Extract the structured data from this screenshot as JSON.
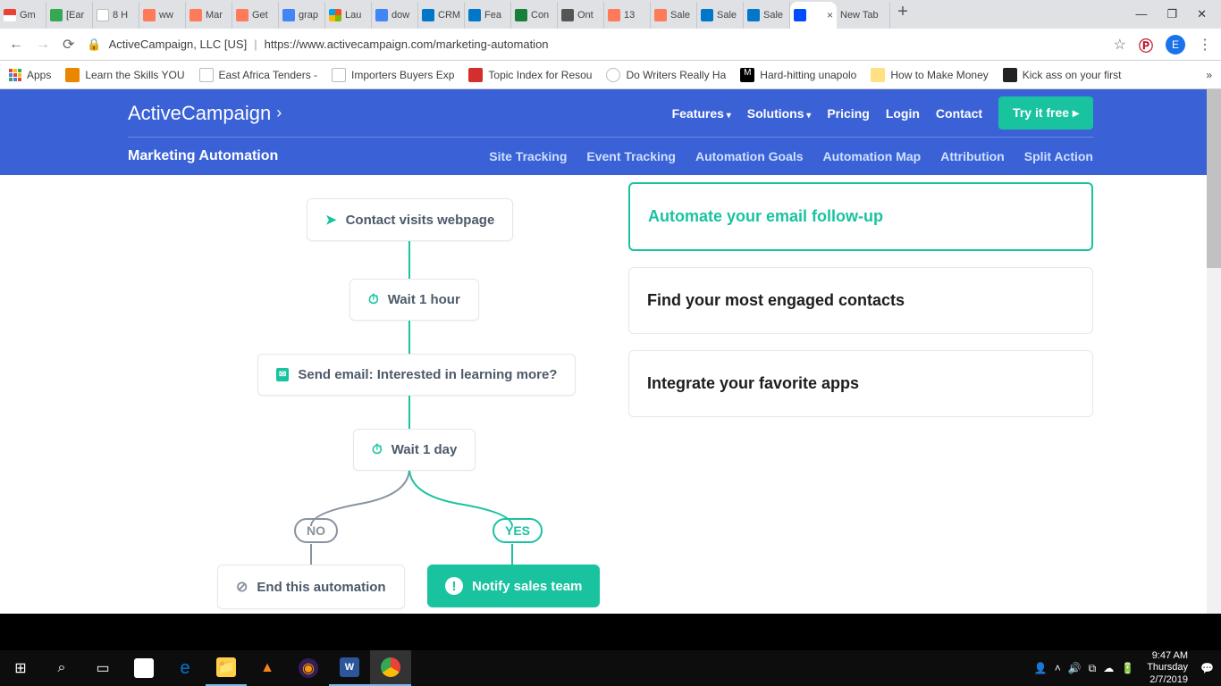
{
  "browser": {
    "tabs": [
      {
        "label": "Gm",
        "color": "#ea4335"
      },
      {
        "label": "[Ear",
        "color": "#34a853"
      },
      {
        "label": "8 H",
        "color": "#fff"
      },
      {
        "label": "ww",
        "color": "#ff7a59"
      },
      {
        "label": "Mar",
        "color": "#ff7a59"
      },
      {
        "label": "Get",
        "color": "#ff7a59"
      },
      {
        "label": "grap",
        "color": "#4285f4"
      },
      {
        "label": "Lau",
        "color": "#00a4ef"
      },
      {
        "label": "dow",
        "color": "#4285f4"
      },
      {
        "label": "CRM",
        "color": "#0077c8"
      },
      {
        "label": "Fea",
        "color": "#0077c8"
      },
      {
        "label": "Con",
        "color": "#188038"
      },
      {
        "label": "Ont",
        "color": "#555"
      },
      {
        "label": "13",
        "color": "#ff7a59"
      },
      {
        "label": "Sale",
        "color": "#ff7a59"
      },
      {
        "label": "Sale",
        "color": "#0077c8"
      },
      {
        "label": "Sale",
        "color": "#0077c8"
      }
    ],
    "active_tab": {
      "label": "",
      "color": "#004cff"
    },
    "newtab_label": "New Tab",
    "address": {
      "host": "ActiveCampaign, LLC [US]",
      "url": "https://www.activecampaign.com/marketing-automation"
    },
    "avatar": "E",
    "bookmarks": [
      {
        "label": "Apps"
      },
      {
        "label": "Learn the Skills YOU"
      },
      {
        "label": "East Africa Tenders -"
      },
      {
        "label": "Importers Buyers Exp"
      },
      {
        "label": "Topic Index for Resou"
      },
      {
        "label": "Do Writers Really Ha"
      },
      {
        "label": "Hard-hitting unapolo"
      },
      {
        "label": "How to Make Money"
      },
      {
        "label": "Kick ass on your first"
      }
    ]
  },
  "site": {
    "logo": "ActiveCampaign",
    "nav": {
      "features": "Features",
      "solutions": "Solutions",
      "pricing": "Pricing",
      "login": "Login",
      "contact": "Contact",
      "cta": "Try it free"
    },
    "subnav": {
      "title": "Marketing Automation",
      "links": [
        "Site Tracking",
        "Event Tracking",
        "Automation Goals",
        "Automation Map",
        "Attribution",
        "Split Action"
      ]
    },
    "cards": [
      "Automate your email follow-up",
      "Find your most engaged contacts",
      "Integrate your favorite apps"
    ],
    "flow": {
      "visit": "Contact visits webpage",
      "wait1": "Wait 1 hour",
      "email": "Send email: Interested in learning more?",
      "wait2": "Wait 1 day",
      "no": "NO",
      "yes": "YES",
      "end": "End this automation",
      "notify": "Notify sales team"
    }
  },
  "taskbar": {
    "time": "9:47 AM",
    "day": "Thursday",
    "date": "2/7/2019"
  }
}
